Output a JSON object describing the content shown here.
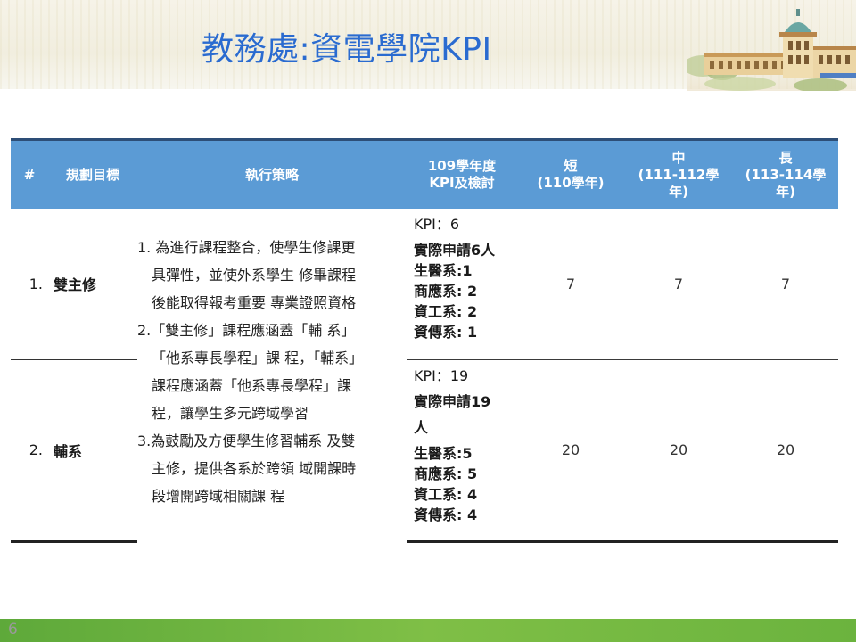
{
  "slide": {
    "title": "教務處:資電學院KPI",
    "page_number": "6"
  },
  "table": {
    "headers": {
      "no": "#",
      "goal": "規劃目標",
      "strategy": "執行策略",
      "kpi_line1": "109學年度",
      "kpi_line2": "KPI及檢討",
      "short_line1": "短",
      "short_line2": "(110學年)",
      "mid_line1": "中",
      "mid_line2": "(111-112學",
      "mid_line3": "年)",
      "long_line1": "長",
      "long_line2": "(113-114學",
      "long_line3": "年)"
    },
    "strategy_lines": [
      "1. 為進行課程整合，使學生修課更",
      "具彈性，並使外系學生 修畢課程",
      "後能取得報考重要 專業證照資格",
      "2.「雙主修」課程應涵蓋「輔 系」",
      "「他系專長學程」課 程，「輔系」",
      "課程應涵蓋「他系專長學程」課",
      "程，讓學生多元跨域學習",
      "3.為鼓勵及方便學生修習輔系 及雙",
      "主修，提供各系於跨領 域開課時",
      "段增開跨域相關課 程"
    ],
    "rows": [
      {
        "no": "1.",
        "goal": "雙主修",
        "kpi_target": "KPI：6",
        "kpi_actual": "實際申請6人",
        "kpi_breakdown": [
          "生醫系:1",
          "商應系: 2",
          "資工系: 2",
          "資傳系: 1"
        ],
        "short": "7",
        "mid": "7",
        "long": "7"
      },
      {
        "no": "2.",
        "goal": "輔系",
        "kpi_target": "KPI：19",
        "kpi_actual_1": "實際申請19",
        "kpi_actual_2": "人",
        "kpi_breakdown": [
          "生醫系:5",
          "商應系: 5",
          "資工系: 4",
          "資傳系: 4"
        ],
        "short": "20",
        "mid": "20",
        "long": "20"
      }
    ]
  },
  "colors": {
    "title": "#2a6bd0",
    "header_fill": "#5b9bd5",
    "footer": "#6bb33e"
  }
}
